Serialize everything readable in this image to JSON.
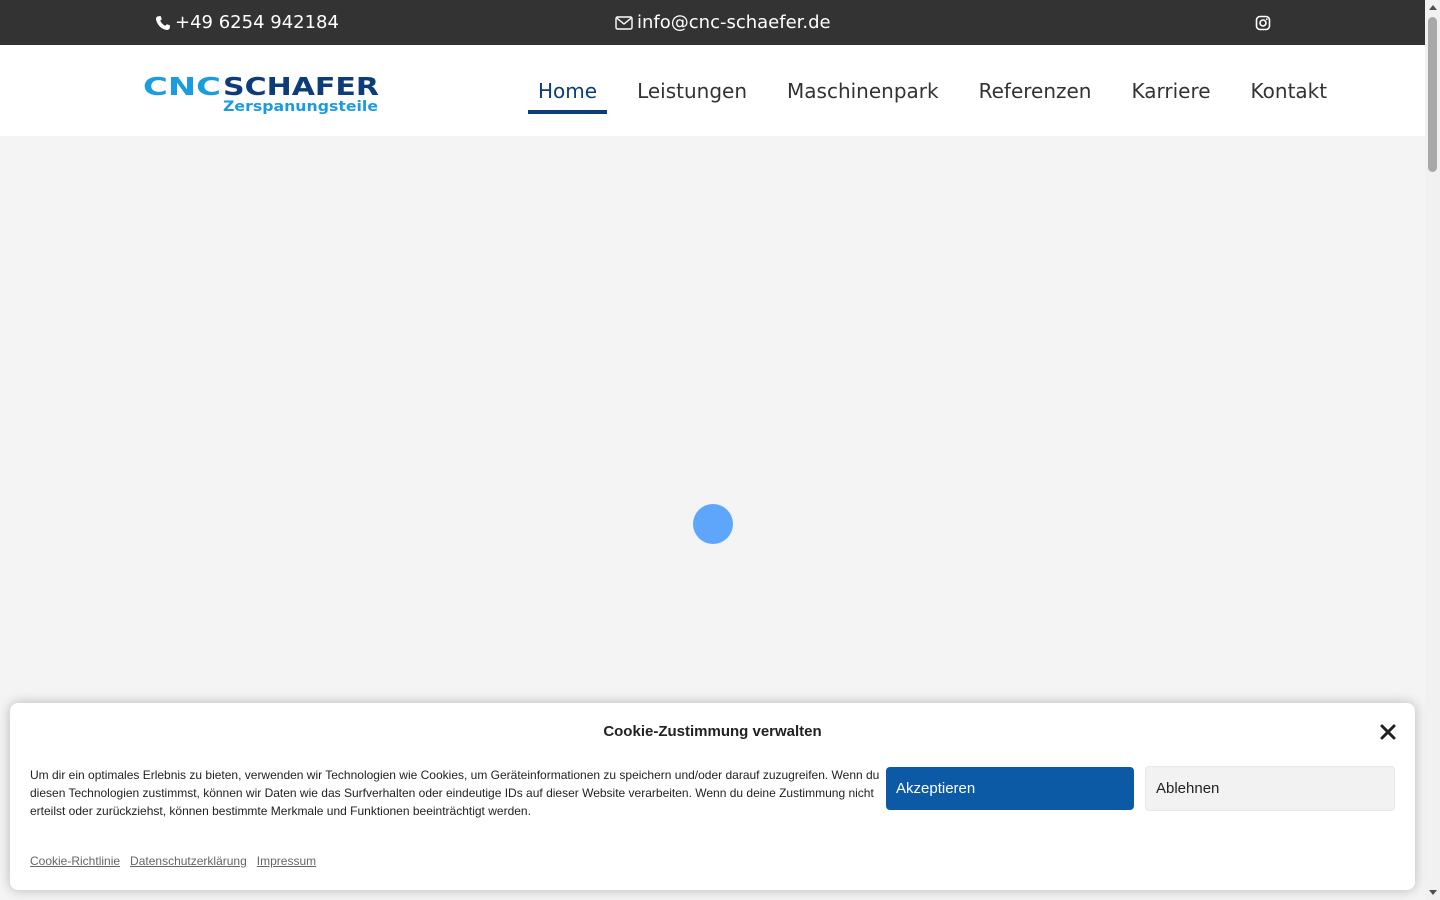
{
  "topbar": {
    "phone": "+49 6254 942184",
    "email": "info@cnc-schaefer.de",
    "phone_icon": "phone-icon",
    "email_icon": "envelope-icon",
    "social_icon": "instagram-icon",
    "background": "#333333"
  },
  "logo": {
    "word1": "CNC",
    "word2": "SCHAFER",
    "tagline": "Zerspanungsteile",
    "color_light": "#1c9ce0",
    "color_dark": "#0c3d78"
  },
  "nav": {
    "items": [
      {
        "label": "Home",
        "active": true
      },
      {
        "label": "Leistungen",
        "active": false
      },
      {
        "label": "Maschinenpark",
        "active": false
      },
      {
        "label": "Referenzen",
        "active": false
      },
      {
        "label": "Karriere",
        "active": false
      },
      {
        "label": "Kontakt",
        "active": false
      }
    ],
    "active_color": "#0c3d78"
  },
  "main": {
    "loader_color": "#5ea6fb"
  },
  "cookie": {
    "title": "Cookie-Zustimmung verwalten",
    "text": "Um dir ein optimales Erlebnis zu bieten, verwenden wir Technologien wie Cookies, um Geräteinformationen zu speichern und/oder darauf zuzugreifen. Wenn du diesen Technologien zustimmst, können wir Daten wie das Surfverhalten oder eindeutige IDs auf dieser Website verarbeiten. Wenn du deine Zustimmung nicht erteilst oder zurückziehst, können bestimmte Merkmale und Funktionen beeinträchtigt werden.",
    "accept_label": "Akzeptieren",
    "decline_label": "Ablehnen",
    "links": [
      "Cookie-Richtlinie",
      "Datenschutzerklärung",
      "Impressum"
    ],
    "accept_color": "#0c5aa6"
  }
}
